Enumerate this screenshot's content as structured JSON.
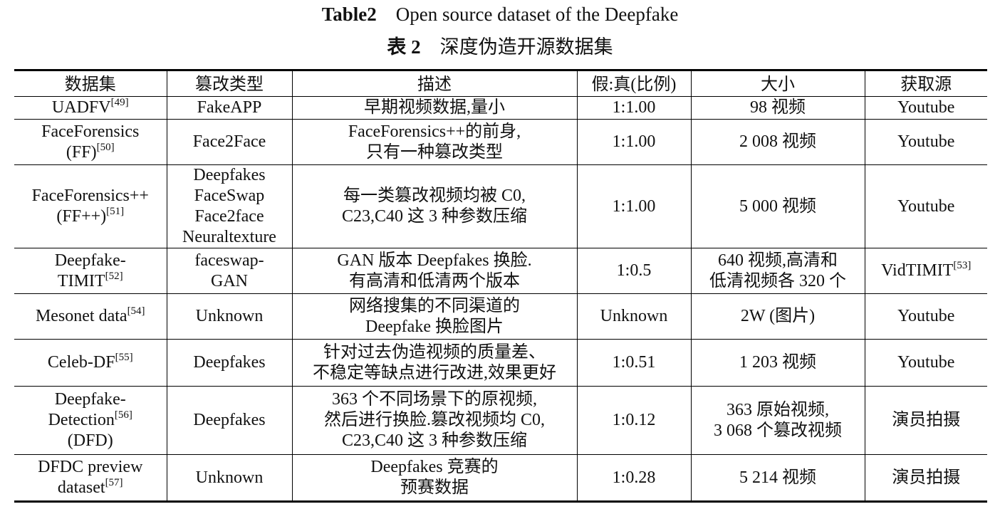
{
  "title_en": {
    "label": "Table2",
    "text": "Open source dataset of the Deepfake"
  },
  "title_zh": {
    "label": "表 2",
    "text": "深度伪造开源数据集"
  },
  "headers": [
    "数据集",
    "篡改类型",
    "描述",
    "假:真(比例)",
    "大小",
    "获取源"
  ],
  "rows": [
    {
      "dataset": "UADFV",
      "ref": "[49]",
      "type": "FakeAPP",
      "desc": "早期视频数据,量小",
      "ratio": "1:1.00",
      "size": "98 视频",
      "source": "Youtube",
      "source_ref": ""
    },
    {
      "dataset": "FaceForensics\n(FF)",
      "ref": "[50]",
      "type": "Face2Face",
      "desc": "FaceForensics++的前身,\n只有一种篡改类型",
      "ratio": "1:1.00",
      "size": "2 008 视频",
      "source": "Youtube",
      "source_ref": ""
    },
    {
      "dataset": "FaceForensics++\n(FF++)",
      "ref": "[51]",
      "type": "Deepfakes\nFaceSwap\nFace2face\nNeuraltexture",
      "desc": "每一类篡改视频均被 C0,\nC23,C40 这 3 种参数压缩",
      "ratio": "1:1.00",
      "size": "5 000 视频",
      "source": "Youtube",
      "source_ref": ""
    },
    {
      "dataset": "Deepfake-\nTIMIT",
      "ref": "[52]",
      "type": "faceswap-\nGAN",
      "desc": "GAN 版本 Deepfakes 换脸.\n有高清和低清两个版本",
      "ratio": "1:0.5",
      "size": "640 视频,高清和\n低清视频各 320 个",
      "source": "VidTIMIT",
      "source_ref": "[53]"
    },
    {
      "dataset": "Mesonet data",
      "ref": "[54]",
      "type": "Unknown",
      "desc": "网络搜集的不同渠道的\nDeepfake 换脸图片",
      "ratio": "Unknown",
      "size": "2W (图片)",
      "source": "Youtube",
      "source_ref": ""
    },
    {
      "dataset": "Celeb-DF",
      "ref": "[55]",
      "type": "Deepfakes",
      "desc": "针对过去伪造视频的质量差、\n不稳定等缺点进行改进,效果更好",
      "ratio": "1:0.51",
      "size": "1 203 视频",
      "source": "Youtube",
      "source_ref": ""
    },
    {
      "dataset": "Deepfake-\nDetection",
      "ref": "[56]",
      "dataset_tail": "\n(DFD)",
      "type": "Deepfakes",
      "desc": "363 个不同场景下的原视频,\n然后进行换脸.篡改视频均 C0,\nC23,C40 这 3 种参数压缩",
      "ratio": "1:0.12",
      "size": "363 原始视频,\n3 068 个篡改视频",
      "source": "演员拍摄",
      "source_ref": ""
    },
    {
      "dataset": "DFDC preview\ndataset",
      "ref": "[57]",
      "type": "Unknown",
      "desc": "Deepfakes 竞赛的\n预赛数据",
      "ratio": "1:0.28",
      "size": "5 214 视频",
      "source": "演员拍摄",
      "source_ref": ""
    }
  ]
}
